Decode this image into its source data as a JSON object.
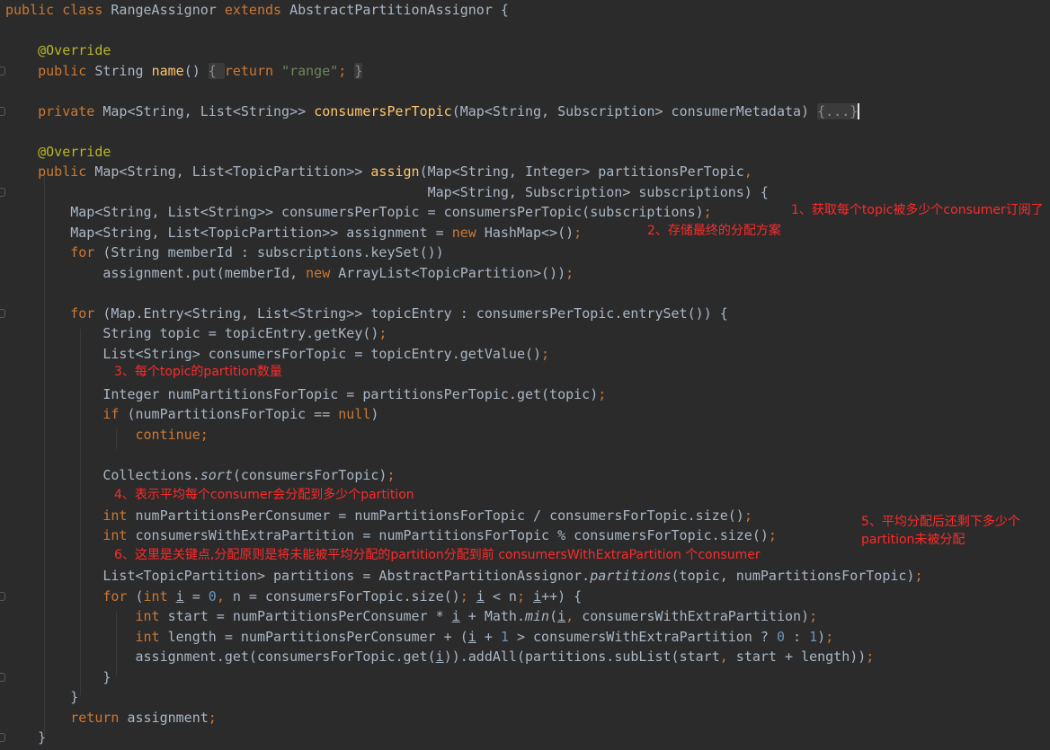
{
  "colors": {
    "background": "#2b2b2b",
    "default_text": "#a9b7c6",
    "keyword": "#cc7832",
    "annotation": "#bbb529",
    "method_declaration": "#ffc66d",
    "string": "#6a8759",
    "number": "#6897bb",
    "fold_placeholder": "#3b3b3b",
    "note_text": "#ff2a2a"
  },
  "code_lines": [
    {
      "tokens": [
        [
          "kw",
          "public class "
        ],
        [
          "",
          "RangeAssignor "
        ],
        [
          "kw",
          "extends "
        ],
        [
          "",
          "AbstractPartitionAssignor {"
        ]
      ]
    },
    {
      "tokens": []
    },
    {
      "tokens": [
        [
          "",
          "    "
        ],
        [
          "an",
          "@Override"
        ]
      ]
    },
    {
      "tokens": [
        [
          "",
          "    "
        ],
        [
          "kw",
          "public "
        ],
        [
          "",
          "String "
        ],
        [
          "fn",
          "name"
        ],
        [
          "",
          "() "
        ],
        [
          "fold",
          "{ "
        ],
        [
          "kw",
          "return "
        ],
        [
          "st",
          "\"range\""
        ],
        [
          "kw",
          "; "
        ],
        [
          "fold",
          "}"
        ]
      ]
    },
    {
      "tokens": []
    },
    {
      "tokens": [
        [
          "",
          "    "
        ],
        [
          "kw",
          "private "
        ],
        [
          "",
          "Map<String, List<String>> "
        ],
        [
          "fn",
          "consumersPerTopic"
        ],
        [
          "",
          "(Map<String, Subscription> consumerMetadata) "
        ],
        [
          "fold",
          "{...}"
        ],
        [
          "caret",
          ""
        ]
      ]
    },
    {
      "tokens": []
    },
    {
      "tokens": [
        [
          "",
          "    "
        ],
        [
          "an",
          "@Override"
        ]
      ]
    },
    {
      "tokens": [
        [
          "",
          "    "
        ],
        [
          "kw",
          "public "
        ],
        [
          "",
          "Map<String, List<TopicPartition>> "
        ],
        [
          "fn",
          "assign"
        ],
        [
          "",
          "(Map<String, Integer> partitionsPerTopic"
        ],
        [
          "kw",
          ","
        ]
      ]
    },
    {
      "tokens": [
        [
          "",
          "                                                    Map<String, Subscription> subscriptions) {"
        ]
      ]
    },
    {
      "tokens": [
        [
          "",
          "        Map<String, List<String>> consumersPerTopic = consumersPerTopic(subscriptions)"
        ],
        [
          "kw",
          ";"
        ]
      ]
    },
    {
      "tokens": [
        [
          "",
          "        Map<String, List<TopicPartition>> assignment = "
        ],
        [
          "kw",
          "new "
        ],
        [
          "",
          "HashMap<>()"
        ],
        [
          "kw",
          ";"
        ]
      ]
    },
    {
      "tokens": [
        [
          "",
          "        "
        ],
        [
          "kw",
          "for "
        ],
        [
          "",
          "(String memberId : subscriptions.keySet())"
        ]
      ]
    },
    {
      "tokens": [
        [
          "",
          "            assignment.put(memberId, "
        ],
        [
          "kw",
          "new "
        ],
        [
          "",
          "ArrayList<TopicPartition>())"
        ],
        [
          "kw",
          ";"
        ]
      ]
    },
    {
      "tokens": []
    },
    {
      "tokens": [
        [
          "",
          "        "
        ],
        [
          "kw",
          "for "
        ],
        [
          "",
          "(Map.Entry<String, List<String>> topicEntry : consumersPerTopic.entrySet()) {"
        ]
      ]
    },
    {
      "tokens": [
        [
          "",
          "            String topic = topicEntry.getKey()"
        ],
        [
          "kw",
          ";"
        ]
      ]
    },
    {
      "tokens": [
        [
          "",
          "            List<String> consumersForTopic = topicEntry.getValue()"
        ],
        [
          "kw",
          ";"
        ]
      ]
    },
    {
      "tokens": []
    },
    {
      "tokens": [
        [
          "",
          "            Integer numPartitionsForTopic = partitionsPerTopic.get(topic)"
        ],
        [
          "kw",
          ";"
        ]
      ]
    },
    {
      "tokens": [
        [
          "",
          "            "
        ],
        [
          "kw",
          "if "
        ],
        [
          "",
          "(numPartitionsForTopic == "
        ],
        [
          "kw",
          "null"
        ],
        [
          "",
          ")"
        ]
      ]
    },
    {
      "tokens": [
        [
          "",
          "                "
        ],
        [
          "kw",
          "continue;"
        ]
      ]
    },
    {
      "tokens": []
    },
    {
      "tokens": [
        [
          "",
          "            Collections."
        ],
        [
          "it",
          "sort"
        ],
        [
          "",
          "(consumersForTopic)"
        ],
        [
          "kw",
          ";"
        ]
      ]
    },
    {
      "tokens": []
    },
    {
      "tokens": [
        [
          "",
          "            "
        ],
        [
          "kw",
          "int "
        ],
        [
          "",
          "numPartitionsPerConsumer = numPartitionsForTopic / consumersForTopic.size()"
        ],
        [
          "kw",
          ";"
        ]
      ]
    },
    {
      "tokens": [
        [
          "",
          "            "
        ],
        [
          "kw",
          "int "
        ],
        [
          "",
          "consumersWithExtraPartition = numPartitionsForTopic % consumersForTopic.size()"
        ],
        [
          "kw",
          ";"
        ]
      ]
    },
    {
      "tokens": []
    },
    {
      "tokens": [
        [
          "",
          "            List<TopicPartition> partitions = AbstractPartitionAssignor."
        ],
        [
          "it",
          "partitions"
        ],
        [
          "",
          "(topic, numPartitionsForTopic)"
        ],
        [
          "kw",
          ";"
        ]
      ]
    },
    {
      "tokens": [
        [
          "",
          "            "
        ],
        [
          "kw",
          "for "
        ],
        [
          "",
          "("
        ],
        [
          "kw",
          "int "
        ],
        [
          "ul",
          "i"
        ],
        [
          "",
          " = "
        ],
        [
          "nu",
          "0"
        ],
        [
          "kw",
          ", "
        ],
        [
          "",
          "n = consumersForTopic.size()"
        ],
        [
          "kw",
          "; "
        ],
        [
          "ul",
          "i"
        ],
        [
          "",
          " < n"
        ],
        [
          "kw",
          "; "
        ],
        [
          "ul",
          "i"
        ],
        [
          "",
          "++) {"
        ]
      ]
    },
    {
      "tokens": [
        [
          "",
          "                "
        ],
        [
          "kw",
          "int "
        ],
        [
          "",
          "start = numPartitionsPerConsumer * "
        ],
        [
          "ul",
          "i"
        ],
        [
          "",
          " + Math."
        ],
        [
          "it",
          "min"
        ],
        [
          "",
          "("
        ],
        [
          "ul",
          "i"
        ],
        [
          "kw",
          ", "
        ],
        [
          "",
          "consumersWithExtraPartition)"
        ],
        [
          "kw",
          ";"
        ]
      ]
    },
    {
      "tokens": [
        [
          "",
          "                "
        ],
        [
          "kw",
          "int "
        ],
        [
          "",
          "length = numPartitionsPerConsumer + ("
        ],
        [
          "ul",
          "i"
        ],
        [
          "",
          " + "
        ],
        [
          "nu",
          "1"
        ],
        [
          "",
          " > consumersWithExtraPartition ? "
        ],
        [
          "nu",
          "0"
        ],
        [
          "",
          " : "
        ],
        [
          "nu",
          "1"
        ],
        [
          "",
          ")"
        ],
        [
          "kw",
          ";"
        ]
      ]
    },
    {
      "tokens": [
        [
          "",
          "                assignment.get(consumersForTopic.get("
        ],
        [
          "ul",
          "i"
        ],
        [
          "",
          "))."
        ],
        [
          "",
          "addAll(partitions.subList(start"
        ],
        [
          "kw",
          ", "
        ],
        [
          "",
          "start + length))"
        ],
        [
          "kw",
          ";"
        ]
      ]
    },
    {
      "tokens": [
        [
          "",
          "            }"
        ]
      ]
    },
    {
      "tokens": [
        [
          "",
          "        }"
        ]
      ]
    },
    {
      "tokens": [
        [
          "",
          "        "
        ],
        [
          "kw",
          "return "
        ],
        [
          "",
          "assignment"
        ],
        [
          "kw",
          ";"
        ]
      ]
    },
    {
      "tokens": [
        [
          "",
          "    }"
        ]
      ]
    }
  ],
  "annotations": [
    {
      "text": "1、获取每个topic被多少个consumer订阅了"
    },
    {
      "text": "2、存储最终的分配方案"
    },
    {
      "text": "3、每个topic的partition数量"
    },
    {
      "text": "4、表示平均每个consumer会分配到多少个partition"
    },
    {
      "text": "5、平均分配后还剩下多少个"
    },
    {
      "text": "partition未被分配"
    },
    {
      "text": "6、这里是关键点,分配原则是将未能被平均分配的partition分配到前 consumersWithExtraPartition 个consumer"
    }
  ]
}
